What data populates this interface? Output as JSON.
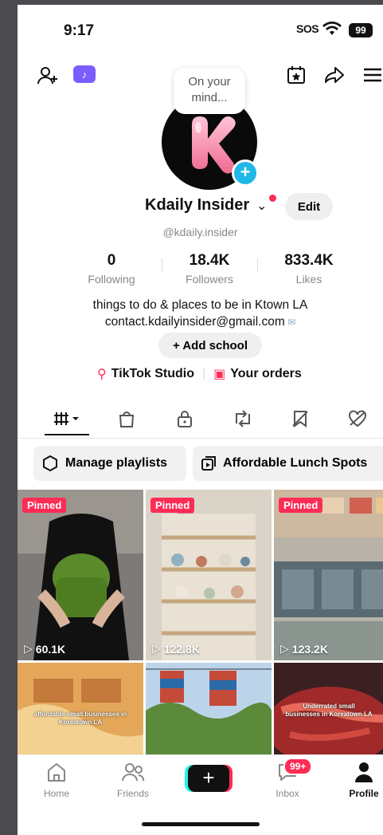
{
  "status_bar": {
    "time": "9:17",
    "carrier": "SOS",
    "battery": "99"
  },
  "header": {
    "left_icons": [
      "add-friend-icon",
      "tiktok-badge-icon"
    ],
    "right_icons": [
      "calendar-star-icon",
      "share-icon",
      "menu-icon"
    ]
  },
  "profile": {
    "bubble_text": "On your mind...",
    "avatar_letter": "K",
    "display_name": "Kdaily Insider",
    "edit_label": "Edit",
    "handle": "@kdaily.insider",
    "stats": [
      {
        "value": "0",
        "label": "Following"
      },
      {
        "value": "18.4K",
        "label": "Followers"
      },
      {
        "value": "833.4K",
        "label": "Likes"
      }
    ],
    "bio_line1": "things to do & places to be in Ktown LA",
    "bio_line2": "contact.kdailyinsider@gmail.com",
    "add_school_label": "+ Add school",
    "studio_label": "TikTok Studio",
    "orders_label": "Your orders"
  },
  "tabs": [
    {
      "name": "videos",
      "icon": "grid-icon",
      "active": true
    },
    {
      "name": "shop",
      "icon": "shopping-bag-icon"
    },
    {
      "name": "private",
      "icon": "lock-icon"
    },
    {
      "name": "reposts",
      "icon": "repost-icon"
    },
    {
      "name": "favorites",
      "icon": "bookmark-icon"
    },
    {
      "name": "liked",
      "icon": "heart-icon"
    }
  ],
  "chips": {
    "manage": "Manage playlists",
    "playlist": "Affordable Lunch Spots"
  },
  "videos": [
    {
      "pinned": "Pinned",
      "views": "60.1K"
    },
    {
      "pinned": "Pinned",
      "views": "122.8K"
    },
    {
      "pinned": "Pinned",
      "views": "123.2K"
    },
    {
      "overlay": "affordable small businesses in Koreatown LA"
    },
    {
      "overlay": ""
    },
    {
      "overlay": "Underrated small businesses in Koreatown LA"
    }
  ],
  "nav": {
    "home": "Home",
    "friends": "Friends",
    "create": "+",
    "inbox": "Inbox",
    "inbox_badge": "99+",
    "profile": "Profile"
  },
  "colors": {
    "accent": "#fe2c55",
    "cyan": "#25f4ee",
    "blue_badge": "#20b8e8"
  }
}
